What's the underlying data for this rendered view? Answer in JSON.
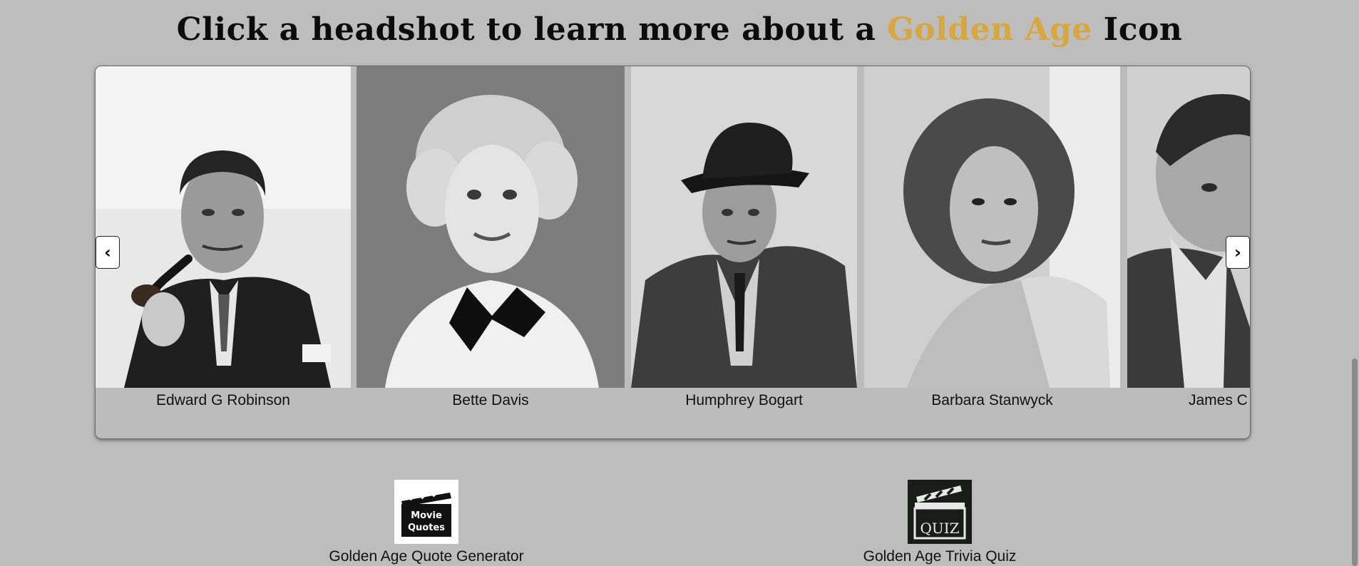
{
  "heading": {
    "prefix": "Click a headshot to learn more about a ",
    "accent": "Golden Age",
    "suffix": " Icon",
    "accent_color": "#d9a73f"
  },
  "carousel": {
    "prev_icon": "‹",
    "next_icon": "›",
    "cards": [
      {
        "name": "Edward G Robinson"
      },
      {
        "name": "Bette Davis"
      },
      {
        "name": "Humphrey Bogart"
      },
      {
        "name": "Barbara Stanwyck"
      },
      {
        "name": "James C"
      }
    ]
  },
  "links": [
    {
      "label": "Golden Age Quote Generator",
      "icon_line1": "Movie",
      "icon_line2": "Quotes",
      "icon": "clapperboard-movie-quotes-icon"
    },
    {
      "label": "Golden Age Trivia Quiz",
      "icon_text": "QUIZ",
      "icon": "clapperboard-quiz-icon"
    }
  ]
}
